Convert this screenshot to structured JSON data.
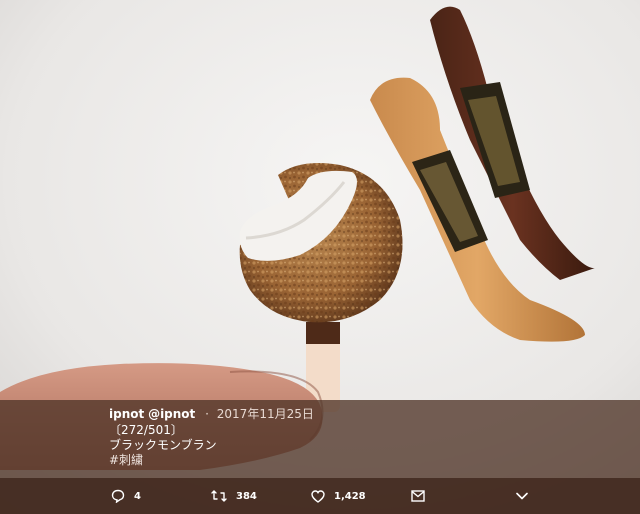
{
  "tweet": {
    "user_name": "ipnot",
    "handle": "@ipnot",
    "separator": "·",
    "date": "2017年11月25日",
    "lines": [
      "〔272/501〕",
      "ブラックモンブラン",
      "#刺繍"
    ]
  },
  "actions": {
    "reply_count": "4",
    "retweet_count": "384",
    "like_count": "1,428"
  },
  "colors": {
    "caption_overlay": "#50342899",
    "action_bar": "#3e241a",
    "text": "#ffffff",
    "secondary_text": "#e8d9d2"
  },
  "icons": [
    "reply-icon",
    "retweet-icon",
    "like-icon",
    "direct-message-icon",
    "more-chevron-icon"
  ]
}
